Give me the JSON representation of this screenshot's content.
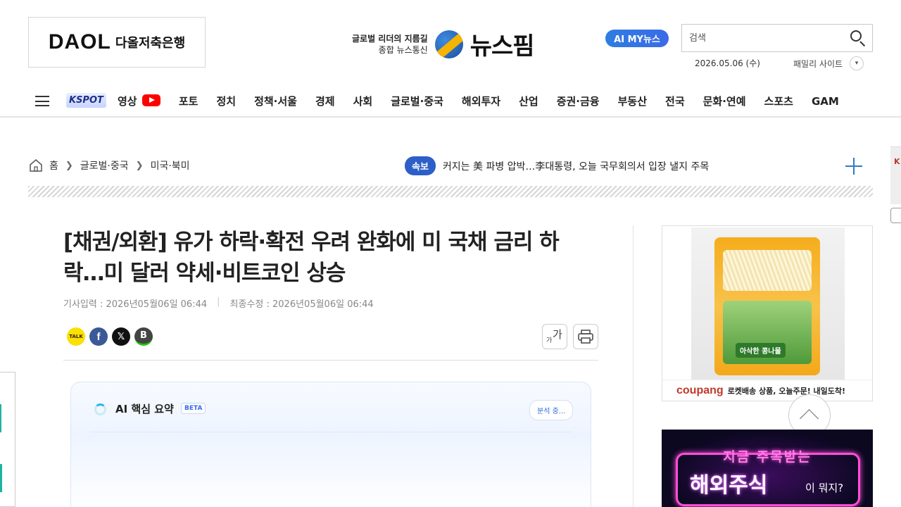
{
  "header": {
    "ad_brand": "DAOL",
    "ad_brand_sub": "다올저축은행",
    "logo_tagline_1": "글로벌 리더의 지름길",
    "logo_tagline_2": "종합 뉴스통신",
    "logo_name": "뉴스핌",
    "ai_button": "AI MY뉴스",
    "search_placeholder": "검색",
    "date": "2026.05.06 (수)",
    "family_site": "패밀리 사이트"
  },
  "nav": {
    "kspot": "KSPOT",
    "items": [
      "영상",
      "포토",
      "정치",
      "정책·서울",
      "경제",
      "사회",
      "글로벌·중국",
      "해외투자",
      "산업",
      "증권·금융",
      "부동산",
      "전국",
      "문화·연예",
      "스포츠",
      "GAM"
    ]
  },
  "breadcrumb": [
    "홈",
    "글로벌·중국",
    "미국·북미"
  ],
  "breaking": {
    "badge": "속보",
    "text": "커지는 美 파병 압박…李대통령, 오늘 국무회의서 입장 낼지 주목"
  },
  "article": {
    "title": "[채권/외환] 유가 하락·확전 우려 완화에 미 국채 금리 하락…미 달러 약세·비트코인 상승",
    "published": "기사입력 : 2026년05월06일 06:44",
    "modified": "최종수정 : 2026년05월06일 06:44",
    "share": {
      "kakao": "TALK",
      "facebook": "f",
      "x": "𝕏",
      "band": "B"
    },
    "font_tool": "가",
    "font_tool_small": "가"
  },
  "ai_summary": {
    "title": "AI 핵심 요약",
    "beta": "BETA",
    "status": "분석 중..."
  },
  "ads": {
    "coupang_brand": "coupang",
    "coupang_text": "로켓배송 상품, 오늘주문! 내일도착!",
    "product_label": "아삭한 콩나물",
    "promo_line1": "지금 주목받는",
    "promo_line2": "해외주식",
    "promo_line3": "이 뭐지?"
  },
  "colors": {
    "accent_blue": "#2d5fc8",
    "youtube_red": "#ff0000",
    "neon_pink": "#ff4fd8"
  }
}
